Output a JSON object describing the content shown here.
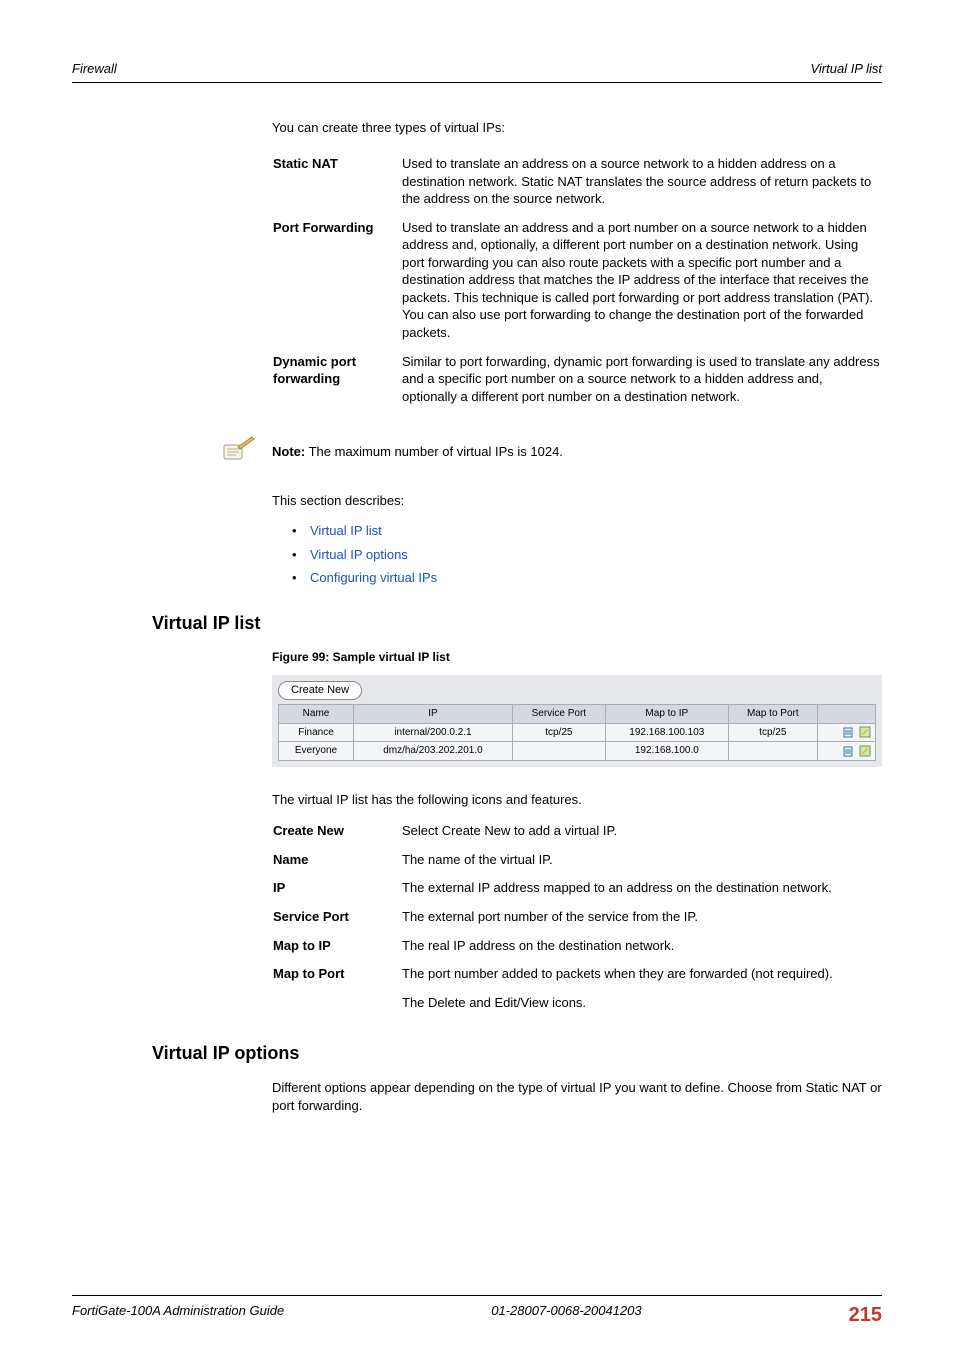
{
  "header": {
    "left": "Firewall",
    "right": "Virtual IP list"
  },
  "intro": "You can create three types of virtual IPs:",
  "types": [
    {
      "term": "Static NAT",
      "desc": "Used to translate an address on a source network to a hidden address on a destination network. Static NAT translates the source address of return packets to the address on the source network."
    },
    {
      "term": "Port Forwarding",
      "desc": "Used to translate an address and a port number on a source network to a hidden address and, optionally, a different port number on a destination network. Using port forwarding you can also route packets with a specific port number and a destination address that matches the IP address of the interface that receives the packets. This technique is called port forwarding or port address translation (PAT). You can also use port forwarding to change the destination port of the forwarded packets."
    },
    {
      "term": "Dynamic port forwarding",
      "desc": "Similar to port forwarding, dynamic port forwarding is used to translate any address and a specific port number on a source network to a hidden address and, optionally a different port number on a destination network."
    }
  ],
  "note": {
    "label": "Note:",
    "text": " The maximum number of virtual IPs is 1024."
  },
  "describes": "This section describes:",
  "links": [
    "Virtual IP list",
    "Virtual IP options",
    "Configuring virtual IPs"
  ],
  "section1": {
    "heading": "Virtual IP list",
    "figure_caption": "Figure 99: Sample virtual IP list",
    "create_btn": "Create New",
    "table": {
      "headers": [
        "Name",
        "IP",
        "Service Port",
        "Map to IP",
        "Map to Port",
        ""
      ],
      "rows": [
        [
          "Finance",
          "internal/200.0.2.1",
          "tcp/25",
          "192.168.100.103",
          "tcp/25"
        ],
        [
          "Everyone",
          "dmz/ha/203.202.201.0",
          "",
          "192.168.100.0",
          ""
        ]
      ]
    },
    "features_intro": "The virtual IP list has the following icons and features.",
    "features": [
      {
        "term": "Create New",
        "desc": "Select Create New to add a virtual IP."
      },
      {
        "term": "Name",
        "desc": "The name of the virtual IP."
      },
      {
        "term": "IP",
        "desc": "The external IP address mapped to an address on the destination network."
      },
      {
        "term": "Service Port",
        "desc": "The external port number of the service from the IP."
      },
      {
        "term": "Map to IP",
        "desc": "The real IP address on the destination network."
      },
      {
        "term": "Map to Port",
        "desc": "The port number added to packets when they are forwarded (not required)."
      },
      {
        "term": "",
        "desc": "The Delete and Edit/View icons."
      }
    ]
  },
  "section2": {
    "heading": "Virtual IP options",
    "text": "Different options appear depending on the type of virtual IP you want to define. Choose from Static NAT or port forwarding."
  },
  "footer": {
    "left": "FortiGate-100A Administration Guide",
    "center": "01-28007-0068-20041203",
    "page": "215"
  }
}
